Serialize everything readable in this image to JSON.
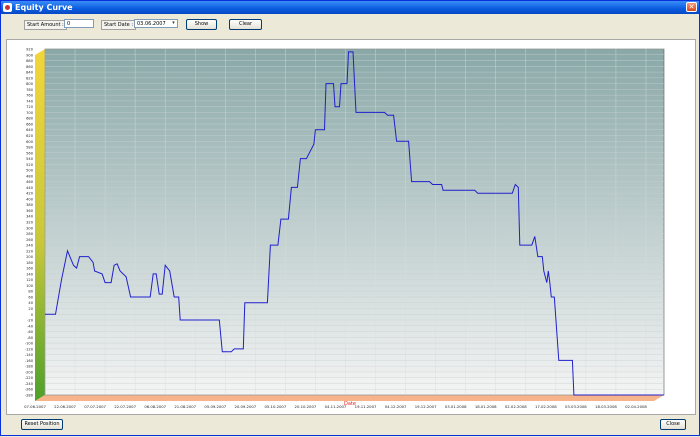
{
  "window": {
    "title": "Equity Curve"
  },
  "toolbar": {
    "start_amount_label": "Start Amount :",
    "start_amount_value": "0",
    "start_date_label": "Start Date :",
    "start_date_value": "03.06.2007",
    "show_label": "Show",
    "clear_label": "Clear"
  },
  "footer": {
    "reset_label": "Reset Position",
    "close_label": "Close"
  },
  "colors": {
    "line": "#2020cc",
    "left_bar_top": "#f2d63a",
    "left_bar_bottom": "#4ea02a",
    "bottom_bar": "#f7b48a",
    "plot_top": "#8aa8a8",
    "plot_bottom": "#f4f4f4"
  },
  "chart_data": {
    "type": "line",
    "title": "",
    "xlabel": "Date",
    "ylabel": "",
    "ylim": [
      -280,
      920
    ],
    "y_ticks": [
      920,
      900,
      880,
      860,
      840,
      820,
      800,
      780,
      760,
      740,
      720,
      700,
      680,
      660,
      640,
      620,
      600,
      580,
      560,
      540,
      520,
      500,
      480,
      460,
      440,
      420,
      400,
      380,
      360,
      340,
      320,
      300,
      280,
      260,
      240,
      220,
      200,
      180,
      160,
      140,
      120,
      100,
      80,
      60,
      40,
      20,
      0,
      -20,
      -40,
      -60,
      -80,
      -100,
      -120,
      -140,
      -160,
      -180,
      -200,
      -220,
      -240,
      -260,
      -280
    ],
    "x_tick_labels": [
      "07.06.2007",
      "22.06.2007",
      "07.07.2007",
      "22.07.2007",
      "06.08.2007",
      "21.08.2007",
      "05.09.2007",
      "20.09.2007",
      "05.10.2007",
      "20.10.2007",
      "04.11.2007",
      "19.11.2007",
      "04.12.2007",
      "19.12.2007",
      "03.01.2008",
      "18.01.2008",
      "02.02.2008",
      "17.02.2008",
      "03.03.2008",
      "18.03.2008",
      "02.04.2008"
    ],
    "x_range": [
      0,
      20.6
    ],
    "grid": true,
    "series": [
      {
        "points": [
          [
            0.0,
            0
          ],
          [
            0.35,
            0
          ],
          [
            0.55,
            120
          ],
          [
            0.75,
            220
          ],
          [
            0.95,
            170
          ],
          [
            1.05,
            160
          ],
          [
            1.15,
            200
          ],
          [
            1.45,
            200
          ],
          [
            1.6,
            180
          ],
          [
            1.65,
            150
          ],
          [
            1.9,
            140
          ],
          [
            2.0,
            110
          ],
          [
            2.2,
            110
          ],
          [
            2.3,
            170
          ],
          [
            2.4,
            175
          ],
          [
            2.5,
            150
          ],
          [
            2.7,
            130
          ],
          [
            2.85,
            60
          ],
          [
            3.5,
            60
          ],
          [
            3.6,
            140
          ],
          [
            3.7,
            140
          ],
          [
            3.8,
            70
          ],
          [
            3.9,
            70
          ],
          [
            4.0,
            170
          ],
          [
            4.15,
            150
          ],
          [
            4.3,
            60
          ],
          [
            4.45,
            60
          ],
          [
            4.5,
            -20
          ],
          [
            5.8,
            -20
          ],
          [
            5.9,
            -130
          ],
          [
            6.2,
            -130
          ],
          [
            6.3,
            -120
          ],
          [
            6.6,
            -120
          ],
          [
            6.65,
            40
          ],
          [
            7.4,
            40
          ],
          [
            7.5,
            240
          ],
          [
            7.75,
            240
          ],
          [
            7.85,
            330
          ],
          [
            8.1,
            330
          ],
          [
            8.2,
            440
          ],
          [
            8.4,
            440
          ],
          [
            8.5,
            540
          ],
          [
            8.7,
            540
          ],
          [
            8.8,
            560
          ],
          [
            8.95,
            590
          ],
          [
            9.0,
            640
          ],
          [
            9.3,
            640
          ],
          [
            9.35,
            800
          ],
          [
            9.6,
            800
          ],
          [
            9.65,
            720
          ],
          [
            9.8,
            720
          ],
          [
            9.85,
            800
          ],
          [
            10.05,
            800
          ],
          [
            10.1,
            910
          ],
          [
            10.25,
            910
          ],
          [
            10.35,
            700
          ],
          [
            11.3,
            700
          ],
          [
            11.4,
            690
          ],
          [
            11.6,
            690
          ],
          [
            11.7,
            600
          ],
          [
            12.1,
            600
          ],
          [
            12.2,
            460
          ],
          [
            12.8,
            460
          ],
          [
            12.9,
            450
          ],
          [
            13.2,
            450
          ],
          [
            13.25,
            430
          ],
          [
            14.3,
            430
          ],
          [
            14.4,
            420
          ],
          [
            15.55,
            420
          ],
          [
            15.65,
            450
          ],
          [
            15.75,
            440
          ],
          [
            15.8,
            240
          ],
          [
            16.2,
            240
          ],
          [
            16.3,
            270
          ],
          [
            16.4,
            200
          ],
          [
            16.55,
            200
          ],
          [
            16.6,
            150
          ],
          [
            16.7,
            110
          ],
          [
            16.75,
            150
          ],
          [
            16.8,
            110
          ],
          [
            16.85,
            60
          ],
          [
            16.95,
            60
          ],
          [
            17.1,
            -160
          ],
          [
            17.55,
            -160
          ],
          [
            17.6,
            -280
          ],
          [
            20.6,
            -280
          ]
        ]
      }
    ]
  }
}
